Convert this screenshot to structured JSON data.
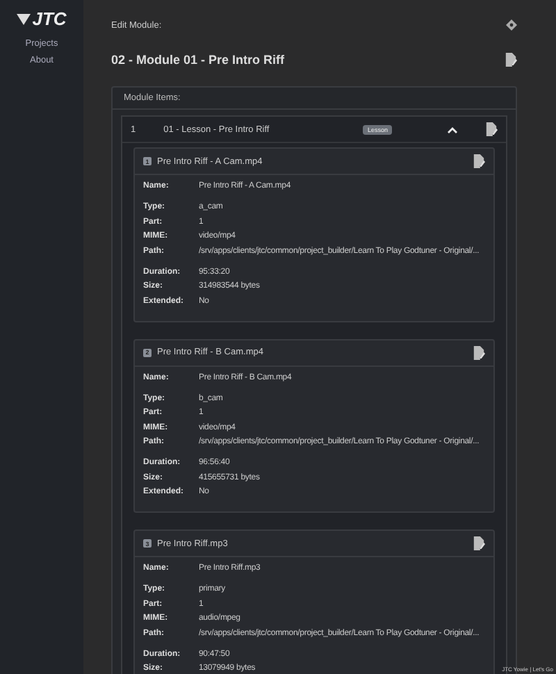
{
  "sidebar": {
    "logo": "JTC",
    "items": [
      {
        "label": "Projects"
      },
      {
        "label": "About"
      }
    ]
  },
  "page": {
    "label": "Edit Module:",
    "title": "02 - Module 01 - Pre Intro Riff"
  },
  "module_items": {
    "title": "Module Items:",
    "items": [
      {
        "number": "1",
        "title": "01 - Lesson - Pre Intro Riff",
        "tag": "Lesson",
        "expanded": true,
        "files": [
          {
            "index": "1",
            "filename": "Pre Intro Riff - A Cam.mp4",
            "groups": [
              [
                {
                  "label": "Name:",
                  "value": "Pre Intro Riff - A Cam.mp4"
                }
              ],
              [
                {
                  "label": "Type:",
                  "value": "a_cam"
                },
                {
                  "label": "Part:",
                  "value": "1"
                },
                {
                  "label": "MIME:",
                  "value": "video/mp4"
                },
                {
                  "label": "Path:",
                  "value": "/srv/apps/clients/jtc/common/project_builder/Learn To Play Godtuner - Original/..."
                }
              ],
              [
                {
                  "label": "Duration:",
                  "value": "95:33:20"
                },
                {
                  "label": "Size:",
                  "value": "314983544 bytes"
                },
                {
                  "label": "Extended:",
                  "value": "No"
                }
              ]
            ]
          },
          {
            "index": "2",
            "filename": "Pre Intro Riff - B Cam.mp4",
            "groups": [
              [
                {
                  "label": "Name:",
                  "value": "Pre Intro Riff - B Cam.mp4"
                }
              ],
              [
                {
                  "label": "Type:",
                  "value": "b_cam"
                },
                {
                  "label": "Part:",
                  "value": "1"
                },
                {
                  "label": "MIME:",
                  "value": "video/mp4"
                },
                {
                  "label": "Path:",
                  "value": "/srv/apps/clients/jtc/common/project_builder/Learn To Play Godtuner - Original/..."
                }
              ],
              [
                {
                  "label": "Duration:",
                  "value": "96:56:40"
                },
                {
                  "label": "Size:",
                  "value": "415655731 bytes"
                },
                {
                  "label": "Extended:",
                  "value": "No"
                }
              ]
            ]
          },
          {
            "index": "3",
            "filename": "Pre Intro Riff.mp3",
            "groups": [
              [
                {
                  "label": "Name:",
                  "value": "Pre Intro Riff.mp3"
                }
              ],
              [
                {
                  "label": "Type:",
                  "value": "primary"
                },
                {
                  "label": "Part:",
                  "value": "1"
                },
                {
                  "label": "MIME:",
                  "value": "audio/mpeg"
                },
                {
                  "label": "Path:",
                  "value": "/srv/apps/clients/jtc/common/project_builder/Learn To Play Godtuner - Original/..."
                }
              ],
              [
                {
                  "label": "Duration:",
                  "value": "90:47:50"
                },
                {
                  "label": "Size:",
                  "value": "13079949 bytes"
                }
              ]
            ]
          }
        ]
      }
    ]
  },
  "footer": "JTC Yowie | Let's Go"
}
